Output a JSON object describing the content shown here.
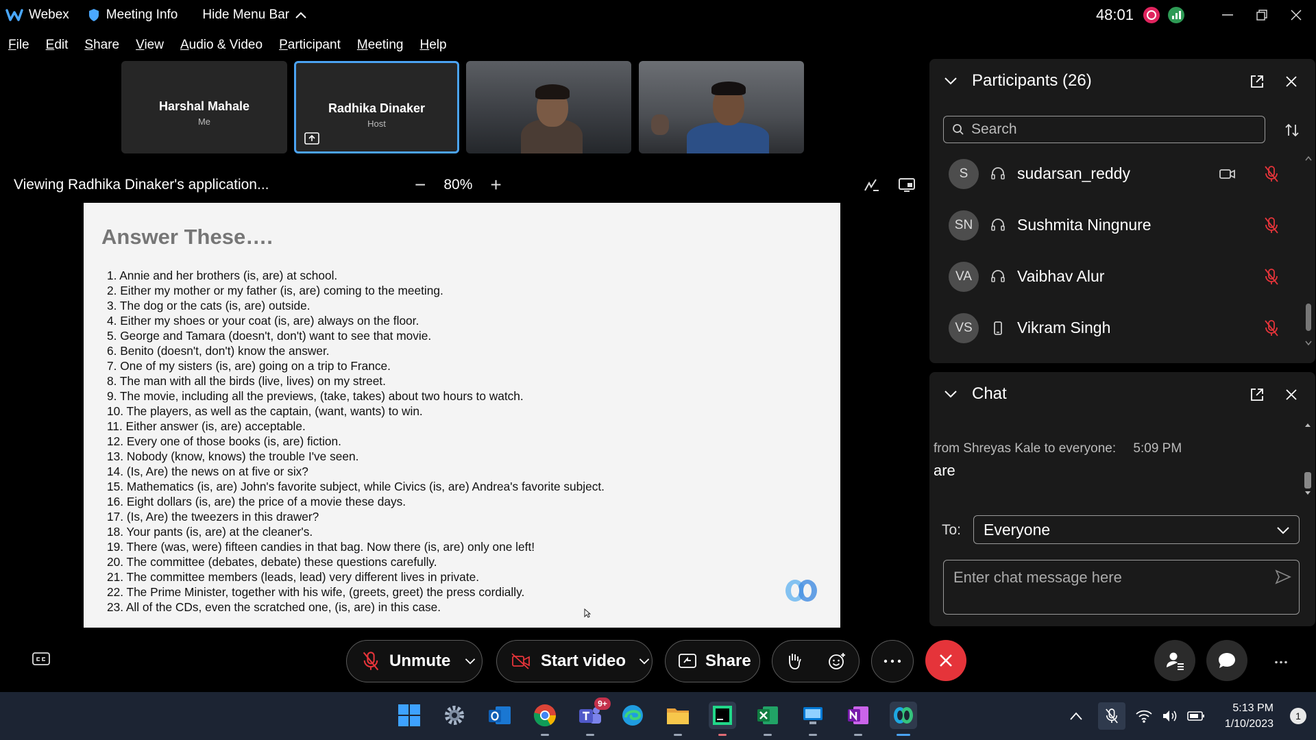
{
  "titlebar": {
    "app_name": "Webex",
    "meeting_info": "Meeting Info",
    "hide_menu": "Hide Menu Bar",
    "timer": "48:01"
  },
  "menubar": {
    "items": [
      {
        "u": "F",
        "rest": "ile"
      },
      {
        "u": "E",
        "rest": "dit"
      },
      {
        "u": "S",
        "rest": "hare"
      },
      {
        "u": "V",
        "rest": "iew"
      },
      {
        "u": "A",
        "rest": "udio & Video"
      },
      {
        "u": "P",
        "rest": "articipant"
      },
      {
        "u": "M",
        "rest": "eeting"
      },
      {
        "u": "H",
        "rest": "elp"
      }
    ]
  },
  "thumbnails": [
    {
      "name": "Harshal Mahale",
      "role": "Me"
    },
    {
      "name": "Radhika Dinaker",
      "role": "Host"
    }
  ],
  "viewbar": {
    "viewing": "Viewing Radhika Dinaker's application...",
    "zoom": "80%",
    "minus": "−",
    "plus": "+"
  },
  "slide": {
    "title": "Answer These….",
    "questions": [
      "1. Annie and her brothers (is, are) at school.",
      "2. Either my mother or my father (is, are) coming to the meeting.",
      "3. The dog or the cats (is, are) outside.",
      "4. Either my shoes or your coat (is, are) always on the floor.",
      "5. George and Tamara (doesn't, don't) want to see that movie.",
      "6. Benito (doesn't, don't) know the answer.",
      "7. One of my sisters (is, are) going on a trip to France.",
      "8. The man with all the birds (live, lives) on my street.",
      "9. The movie, including all the previews, (take, takes) about two hours to watch.",
      "10. The players, as well as the captain, (want, wants) to win.",
      "11. Either answer (is, are) acceptable.",
      "12. Every one of those books (is, are) fiction.",
      "13. Nobody (know, knows) the trouble I've seen.",
      "14. (Is, Are) the news on at five or six?",
      "15. Mathematics (is, are) John's favorite subject, while Civics (is, are) Andrea's favorite subject.",
      "16. Eight dollars (is, are) the price of a movie these days.",
      "17. (Is, Are) the tweezers in this drawer?",
      "18. Your pants (is, are) at the cleaner's.",
      "19. There (was, were) fifteen candies in that bag. Now there (is, are) only one left!",
      "20. The committee (debates, debate) these questions carefully.",
      "21. The committee members (leads, lead) very different lives in private.",
      "22. The Prime Minister, together with his wife, (greets, greet) the press cordially.",
      "23. All of the CDs, even the scratched one, (is, are) in this case."
    ]
  },
  "participants": {
    "title": "Participants (26)",
    "search_placeholder": "Search",
    "list": [
      {
        "initials": "S",
        "name": "sudarsan_reddy",
        "device": "headset-icon",
        "video": true
      },
      {
        "initials": "SN",
        "name": "Sushmita Ningnure",
        "device": "headset-icon",
        "video": false
      },
      {
        "initials": "VA",
        "name": "Vaibhav Alur",
        "device": "headset-icon",
        "video": false
      },
      {
        "initials": "VS",
        "name": "Vikram Singh",
        "device": "phone-icon",
        "video": false
      }
    ]
  },
  "chat": {
    "title": "Chat",
    "message_meta": "from Shreyas Kale to everyone:",
    "message_time": "5:09 PM",
    "message_text": "are",
    "to_label": "To:",
    "to_value": "Everyone",
    "input_placeholder": "Enter chat message here"
  },
  "controls": {
    "unmute": "Unmute",
    "start_video": "Start video",
    "share": "Share",
    "end_color": "#e5343a"
  },
  "taskbar": {
    "teams_badge": "9+",
    "time": "5:13 PM",
    "date": "1/10/2023",
    "notifications": "1"
  },
  "colors": {
    "accent": "#4ba3f2",
    "record": "#e0245e",
    "mute": "#e5343a"
  }
}
